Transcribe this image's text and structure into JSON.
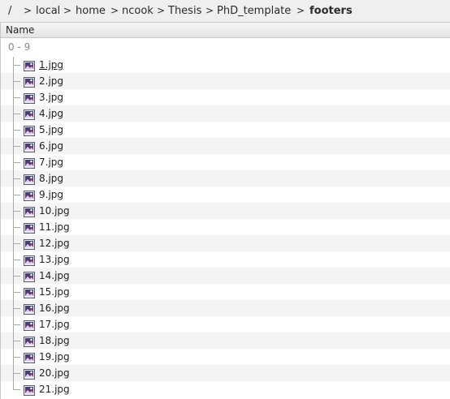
{
  "breadcrumb": {
    "root": "/",
    "segments": [
      "local",
      "home",
      "ncook",
      "Thesis",
      "PhD_template"
    ],
    "current": "footers",
    "separator": ">"
  },
  "header": {
    "name_column": "Name"
  },
  "group": {
    "label": "0 - 9"
  },
  "files": [
    "1.jpg",
    "2.jpg",
    "3.jpg",
    "4.jpg",
    "5.jpg",
    "6.jpg",
    "7.jpg",
    "8.jpg",
    "9.jpg",
    "10.jpg",
    "11.jpg",
    "12.jpg",
    "13.jpg",
    "14.jpg",
    "15.jpg",
    "16.jpg",
    "17.jpg",
    "18.jpg",
    "19.jpg",
    "20.jpg",
    "21.jpg"
  ],
  "icons": {
    "file": "image-file-icon"
  },
  "colors": {
    "alt_row": "#f4f4f4",
    "group_text": "#8a8a8a"
  }
}
